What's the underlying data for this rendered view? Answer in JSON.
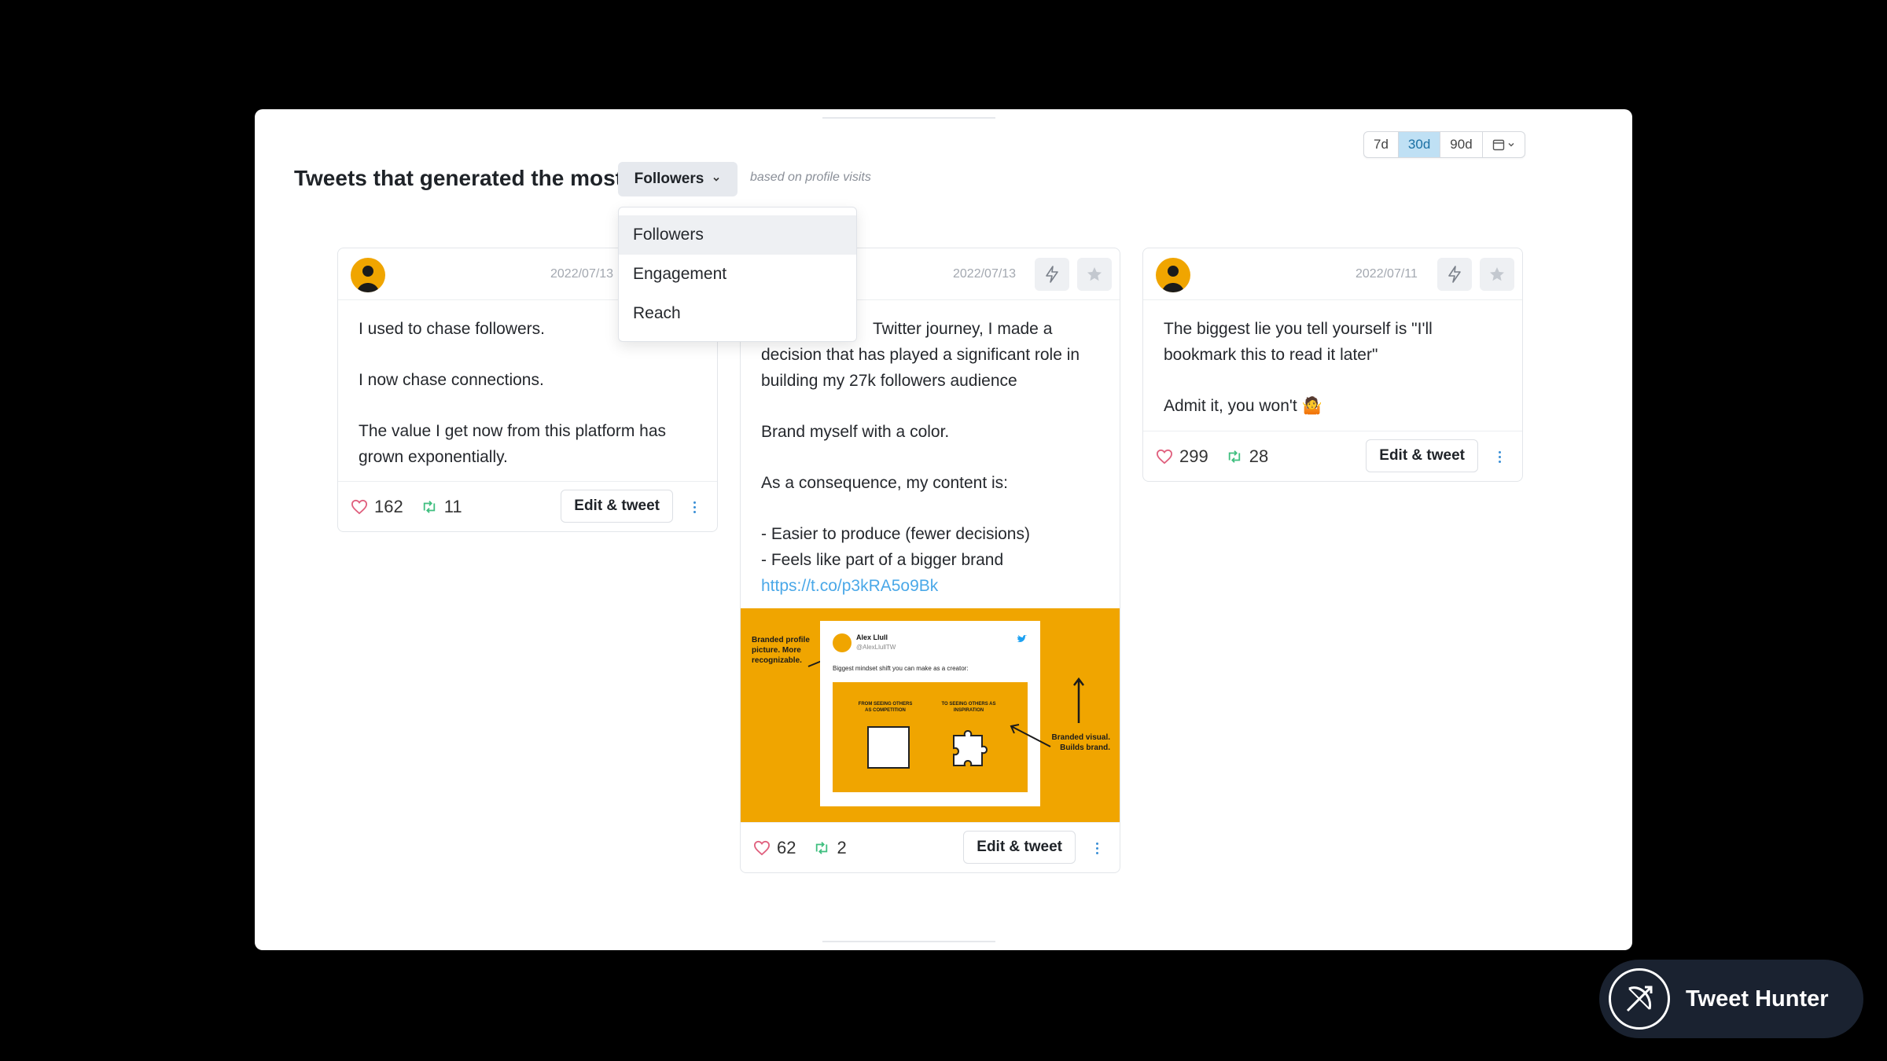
{
  "header": {
    "title": "Tweets that generated the most",
    "selected_metric": "Followers",
    "hint": "based on profile visits"
  },
  "date_range": {
    "options": [
      "7d",
      "30d",
      "90d"
    ],
    "active": "30d",
    "calendar_icon": "calendar-icon"
  },
  "dropdown": {
    "items": [
      "Followers",
      "Engagement",
      "Reach"
    ],
    "active": "Followers"
  },
  "tweets": [
    {
      "date": "2022/07/13",
      "paragraphs": [
        "I used to chase followers.",
        "I now chase connections.",
        "The value I get now from this platform has grown exponentially."
      ],
      "likes": "162",
      "retweets": "11",
      "edit_label": "Edit & tweet"
    },
    {
      "date": "2022/07/13",
      "lines_visible": [
        "Twitter journey, I made a",
        "decision that has played a significant role in",
        "building my 27k followers audience"
      ],
      "line2": "Brand myself with a color.",
      "line3": "As a consequence, my content is:",
      "bullet1": "- Easier to produce (fewer decisions)",
      "bullet2": "- Feels like part of a bigger brand",
      "link": "https://t.co/p3kRA5o9Bk",
      "image": {
        "left_note": "Branded profile picture. More recognizable.",
        "right_note": "Branded visual. Builds brand.",
        "author": "Alex Llull",
        "handle": "@AlexLlullTW",
        "caption": "Biggest mindset shift you can make as a creator:",
        "label_left": "FROM SEEING OTHERS AS COMPETITION",
        "label_right": "TO SEEING OTHERS AS INSPIRATION"
      },
      "likes": "62",
      "retweets": "2",
      "edit_label": "Edit & tweet"
    },
    {
      "date": "2022/07/11",
      "line1": "The biggest lie you tell yourself is \"I'll bookmark this to read it later\"",
      "line2": "Admit it, you won't 🤷",
      "likes": "299",
      "retweets": "28",
      "edit_label": "Edit & tweet"
    }
  ],
  "promo": {
    "label": "Tweet Hunter"
  },
  "colors": {
    "accent": "#f0a500",
    "link": "#4aa8e8",
    "like": "#e0607e",
    "retweet": "#3fbf7f"
  }
}
